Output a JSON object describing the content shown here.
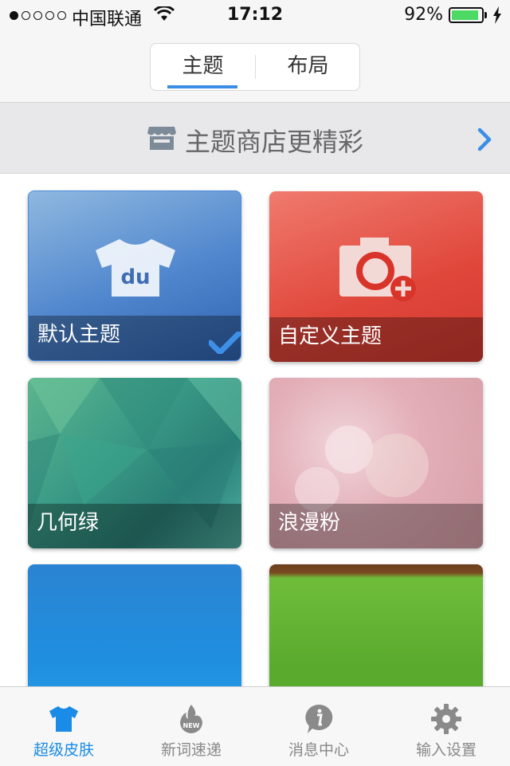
{
  "status_bar": {
    "carrier": "中国联通",
    "time": "17:12",
    "battery_percent": "92%",
    "battery_level": 0.92,
    "signal_bars_filled": 1,
    "signal_bars_total": 5
  },
  "tabs": {
    "items": [
      {
        "label": "主题",
        "selected": true
      },
      {
        "label": "布局",
        "selected": false
      }
    ]
  },
  "banner": {
    "text": "主题商店更精彩",
    "icon": "store-icon"
  },
  "themes": [
    {
      "label": "默认主题",
      "selected": true,
      "icon": "tshirt-du-icon"
    },
    {
      "label": "自定义主题",
      "selected": false,
      "icon": "camera-add-icon"
    },
    {
      "label": "几何绿",
      "selected": false
    },
    {
      "label": "浪漫粉",
      "selected": false
    },
    {
      "label": "",
      "selected": false
    },
    {
      "label": "",
      "selected": false
    }
  ],
  "tabbar": {
    "items": [
      {
        "label": "超级皮肤",
        "icon": "tshirt-icon",
        "active": true
      },
      {
        "label": "新词速递",
        "icon": "new-flame-icon",
        "active": false
      },
      {
        "label": "消息中心",
        "icon": "info-icon",
        "active": false
      },
      {
        "label": "输入设置",
        "icon": "gear-icon",
        "active": false
      }
    ]
  },
  "colors": {
    "accent": "#1a8be6",
    "tab_underline": "#3b8ee6"
  }
}
